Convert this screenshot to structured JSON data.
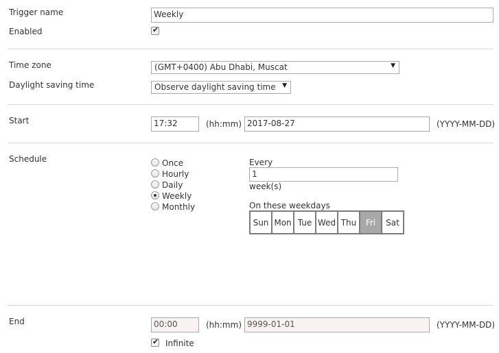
{
  "trigger": {
    "name_label": "Trigger name",
    "name_value": "Weekly",
    "enabled_label": "Enabled",
    "enabled_checked": true
  },
  "timezone": {
    "label": "Time zone",
    "value": "(GMT+0400) Abu Dhabi, Muscat",
    "dst_label": "Daylight saving time",
    "dst_value": "Observe daylight saving time"
  },
  "start": {
    "label": "Start",
    "time_value": "17:32",
    "time_hint": "(hh:mm)",
    "date_value": "2017-08-27",
    "date_hint": "(YYYY-MM-DD)"
  },
  "schedule": {
    "label": "Schedule",
    "options": [
      {
        "label": "Once",
        "checked": false
      },
      {
        "label": "Hourly",
        "checked": false
      },
      {
        "label": "Daily",
        "checked": false
      },
      {
        "label": "Weekly",
        "checked": true
      },
      {
        "label": "Monthly",
        "checked": false
      }
    ],
    "every_label": "Every",
    "every_value": "1",
    "unit_label": "week(s)",
    "weekdays_label": "On these weekdays",
    "weekdays": [
      {
        "label": "Sun",
        "selected": false
      },
      {
        "label": "Mon",
        "selected": false
      },
      {
        "label": "Tue",
        "selected": false
      },
      {
        "label": "Wed",
        "selected": false
      },
      {
        "label": "Thu",
        "selected": false
      },
      {
        "label": "Fri",
        "selected": true
      },
      {
        "label": "Sat",
        "selected": false
      }
    ]
  },
  "end": {
    "label": "End",
    "time_value": "00:00",
    "time_hint": "(hh:mm)",
    "date_value": "9999-01-01",
    "date_hint": "(YYYY-MM-DD)",
    "infinite_label": "Infinite",
    "infinite_checked": true
  }
}
